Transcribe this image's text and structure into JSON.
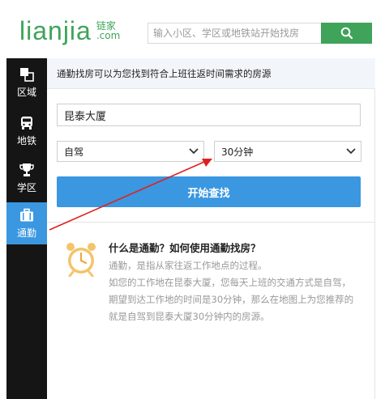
{
  "header": {
    "logo_text": "lianjia",
    "logo_cn": "链家",
    "logo_com": ".com",
    "search_placeholder": "输入小区、学区或地铁站开始找房"
  },
  "sidebar": {
    "items": [
      {
        "label": "区域",
        "icon": "region-icon"
      },
      {
        "label": "地铁",
        "icon": "subway-icon"
      },
      {
        "label": "学区",
        "icon": "trophy-icon"
      },
      {
        "label": "通勤",
        "icon": "briefcase-icon",
        "active": true
      }
    ]
  },
  "commute": {
    "intro": "通勤找房可以为您找到符合上班往返时间需求的房源",
    "address_value": "昆泰大厦",
    "mode_value": "自驾",
    "time_value": "30分钟",
    "start_button": "开始查找"
  },
  "help": {
    "title": "什么是通勤？如何使用通勤找房？",
    "lines": [
      "通勤，是指从家往返工作地点的过程。",
      "如您的工作地在昆泰大厦，您每天上班的交通方式是自驾，",
      "期望到达工作地的时间是30分钟，那么在地图上为您推荐的",
      "就是自驾到昆泰大厦30分钟内的房源。"
    ]
  },
  "colors": {
    "brand_green": "#3fa35a",
    "accent_blue": "#3a97e0",
    "sidebar_bg": "#151515",
    "annotation_red": "#e02020"
  }
}
